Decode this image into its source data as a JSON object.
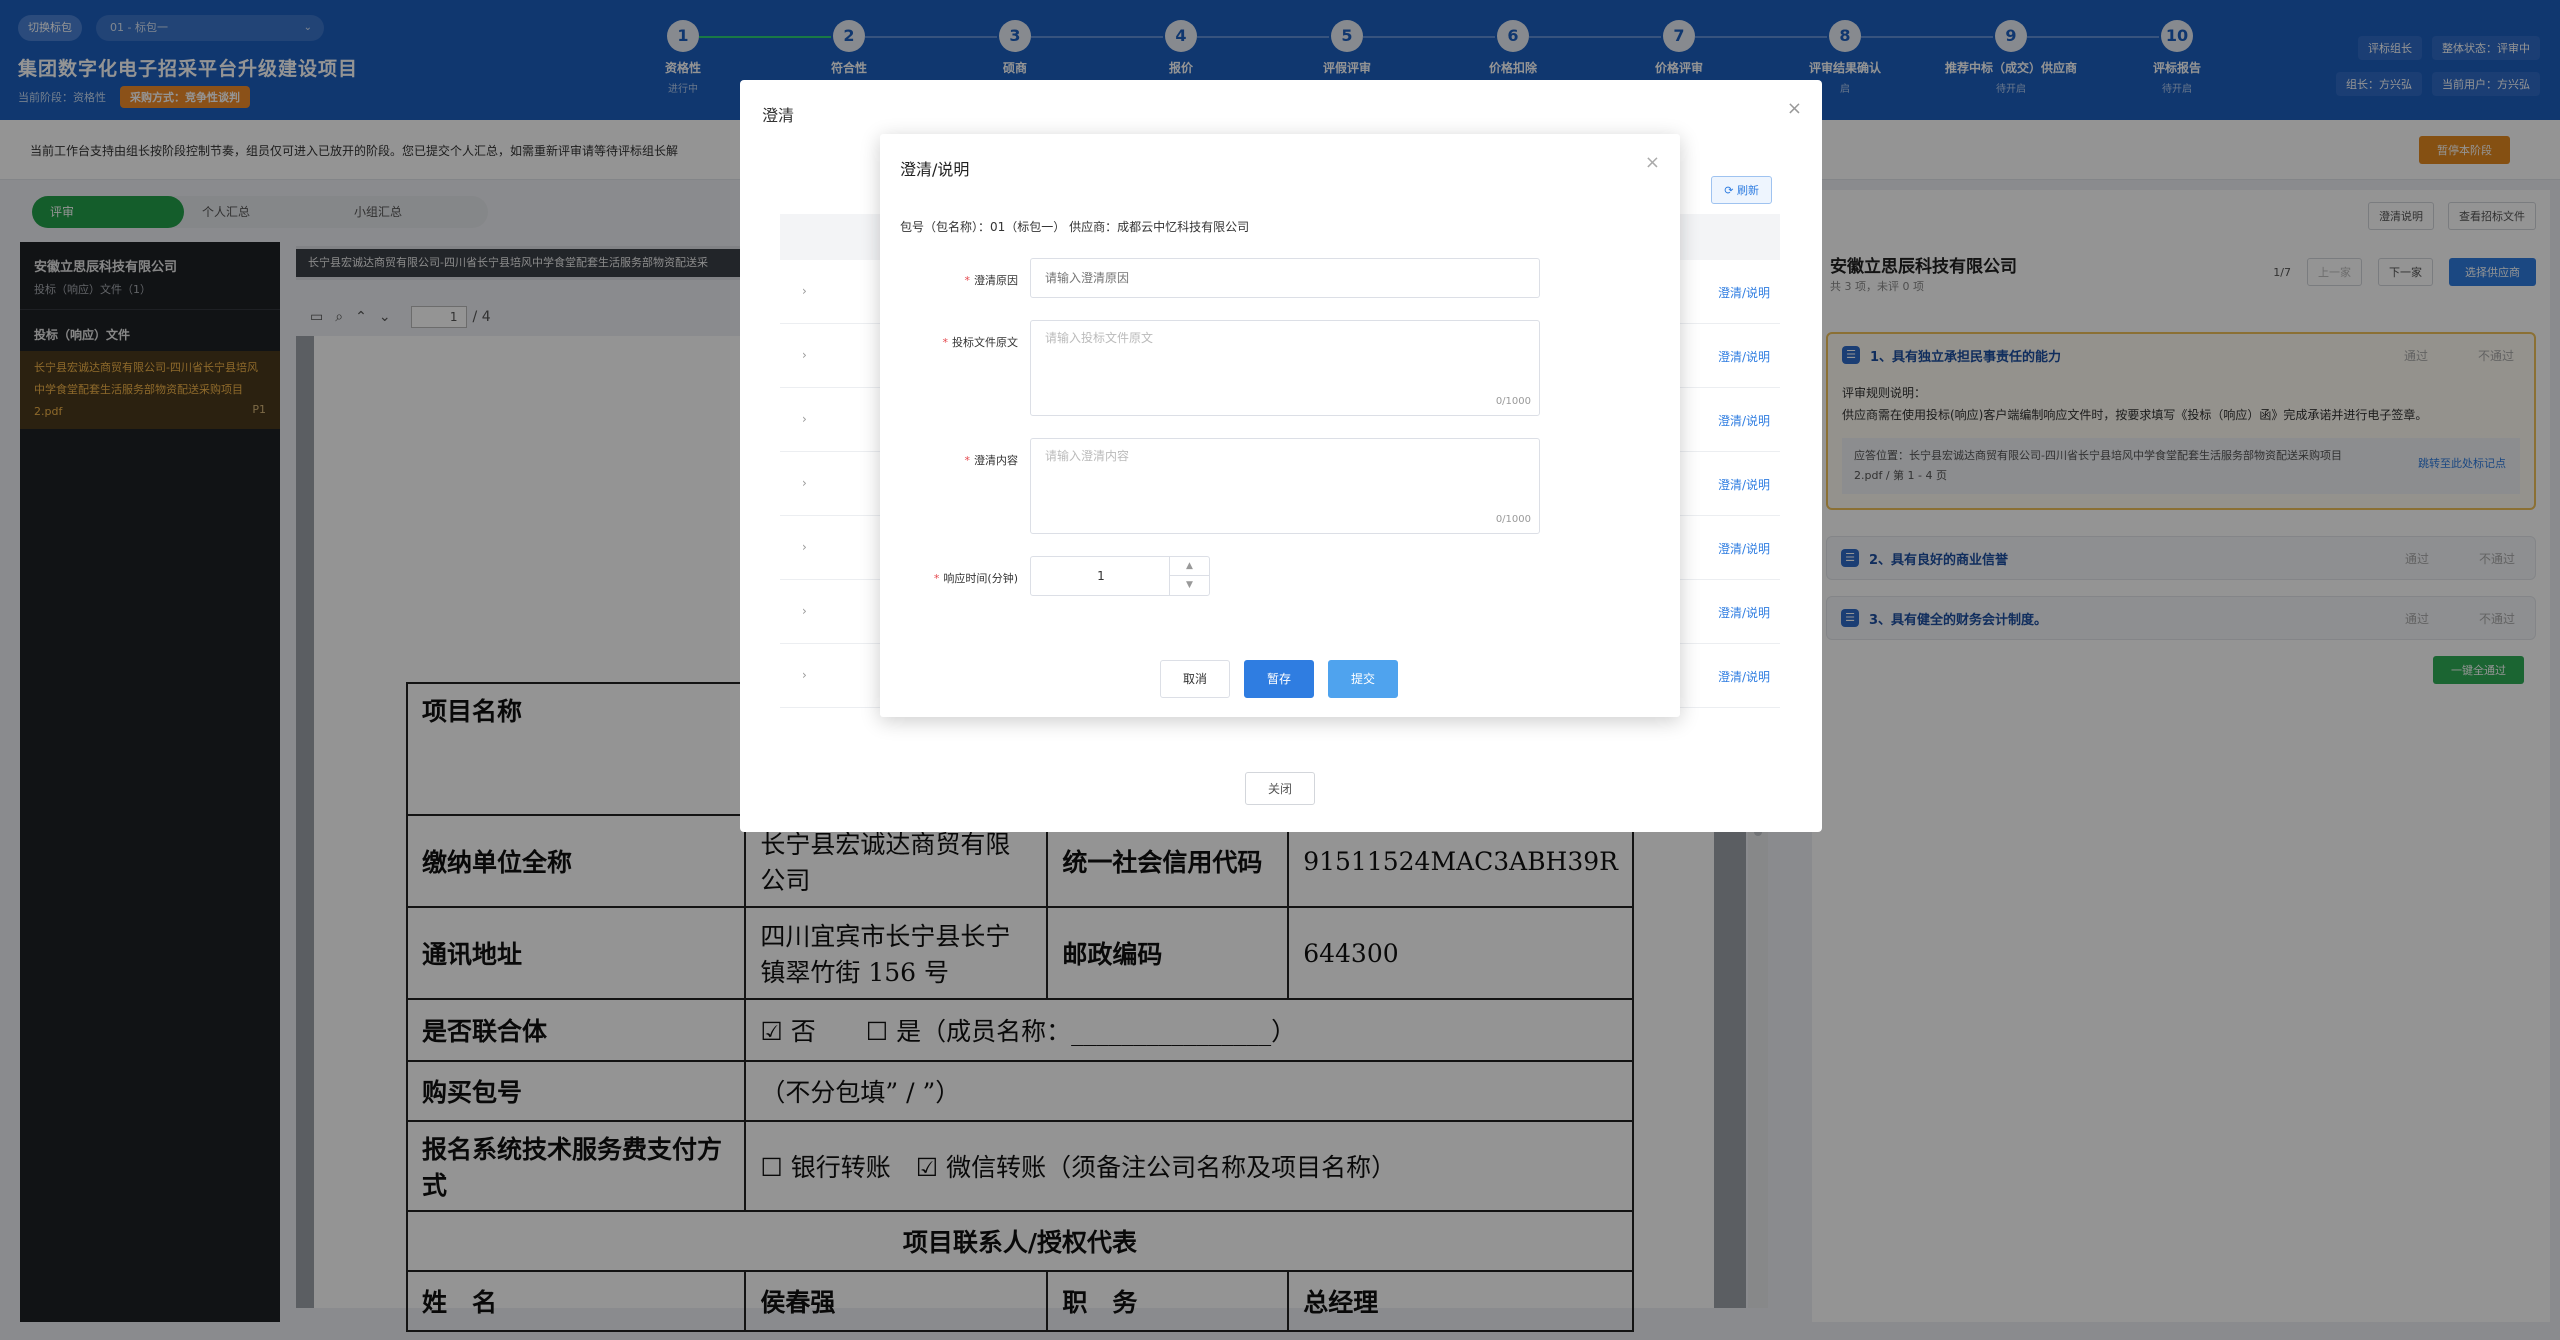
{
  "header": {
    "pkg_switch_label": "切换标包",
    "pkg_selected": "01 - 标包一",
    "project_title": "集团数字化电子招采平台升级建设项目",
    "current_stage": "当前阶段：资格性",
    "purchase_method": "采购方式：竞争性谈判",
    "steps": [
      {
        "num": "1",
        "name": "资格性",
        "state": "进行中"
      },
      {
        "num": "2",
        "name": "符合性",
        "state": ""
      },
      {
        "num": "3",
        "name": "硕商",
        "state": ""
      },
      {
        "num": "4",
        "name": "报价",
        "state": ""
      },
      {
        "num": "5",
        "name": "评假评审",
        "state": ""
      },
      {
        "num": "6",
        "name": "价格扣除",
        "state": ""
      },
      {
        "num": "7",
        "name": "价格评审",
        "state": ""
      },
      {
        "num": "8",
        "name": "评审结果确认",
        "state": "启"
      },
      {
        "num": "9",
        "name": "推荐中标（成交）供应商",
        "state": "待开启"
      },
      {
        "num": "10",
        "name": "评标报告",
        "state": "待开启"
      }
    ],
    "role": "评标组长",
    "overall_status": "整体状态：评审中",
    "leader": "组长：方兴弘",
    "current_user": "当前用户：方兴弘"
  },
  "notice": {
    "text": "当前工作台支持由组长按阶段控制节奏，组员仅可进入已放开的阶段。您已提交个人汇总，如需重新评审请等待评标组长解",
    "pause_button": "暂停本阶段"
  },
  "tabs": [
    "评审",
    "个人汇总",
    "小组汇总"
  ],
  "files": {
    "company": "安徽立思辰科技有限公司",
    "subtitle": "投标（响应）文件（1）",
    "group": "投标（响应）文件",
    "file_name": "长宁县宏诚达商贸有限公司-四川省长宁县培风中学食堂配套生活服务部物资配送采购项目2.pdf",
    "file_page": "P1"
  },
  "viewer": {
    "tab_title": "长宁县宏诚达商贸有限公司-四川省长宁县培风中学食堂配套生活服务部物资配送采",
    "page_current": "1",
    "page_total": "/ 4"
  },
  "doc_table": {
    "project_name_label": "项目名称",
    "payer_label": "缴纳单位全称",
    "payer_value": "长宁县宏诚达商贸有限公司",
    "credit_label": "统一社会信用代码",
    "credit_value": "91511524MAC3ABH39R",
    "address_label": "通讯地址",
    "address_value": "四川宜宾市长宁县长宁镇翠竹街 156 号",
    "postcode_label": "邮政编码",
    "postcode_value": "644300",
    "consortium_label": "是否联合体",
    "consortium_value": "☑ 否　　☐ 是（成员名称：________________）",
    "package_label": "购买包号",
    "package_value": "（不分包填” / ”）",
    "payment_label": "报名系统技术服务费支付方式",
    "payment_value": "☐ 银行转账　☑ 微信转账（须备注公司名称及项目名称）",
    "contact_header": "项目联系人/授权代表",
    "name_label": "姓　名",
    "name_value": "侯春强",
    "position_label": "职　务",
    "position_value": "总经理"
  },
  "right": {
    "clarify_button": "澄清说明",
    "view_doc_button": "查看招标文件",
    "company": "安徽立思辰科技有限公司",
    "count": "共 3 项，未评 0 项",
    "pager": "1/7",
    "prev": "上一家",
    "next": "下一家",
    "select_supplier": "选择供应商",
    "criteria": [
      {
        "title": "1、具有独立承担民事责任的能力",
        "pass": "通过",
        "fail": "不通过"
      },
      {
        "title": "2、具有良好的商业信誉",
        "pass": "通过",
        "fail": "不通过"
      },
      {
        "title": "3、具有健全的财务会计制度。",
        "pass": "通过",
        "fail": "不通过"
      }
    ],
    "rule_label": "评审规则说明：",
    "rule_text": "供应商需在使用投标(响应)客户端编制响应文件时，按要求填写《投标（响应）函》完成承诺并进行电子签章。",
    "location": "应答位置：长宁县宏诚达商贸有限公司-四川省长宁县培风中学食堂配套生活服务部物资配送采购项目2.pdf / 第 1 - 4 页",
    "jump": "跳转至此处标记点",
    "all_pass": "一键全通过"
  },
  "outer_modal": {
    "title": "澄清",
    "refresh": "刷新",
    "row_action": "澄清/说明",
    "close_button": "关闭"
  },
  "dialog": {
    "title": "澄清/说明",
    "info": "包号（包名称）：01（标包一）  供应商：成都云中忆科技有限公司",
    "reason_label": "澄清原因",
    "reason_placeholder": "请输入澄清原因",
    "original_label": "投标文件原文",
    "original_placeholder": "请输入投标文件原文",
    "content_label": "澄清内容",
    "content_placeholder": "请输入澄清内容",
    "counter": "0/1000",
    "response_label": "响应时间(分钟)",
    "response_value": "1",
    "cancel": "取消",
    "save": "暂存",
    "submit": "提交"
  }
}
